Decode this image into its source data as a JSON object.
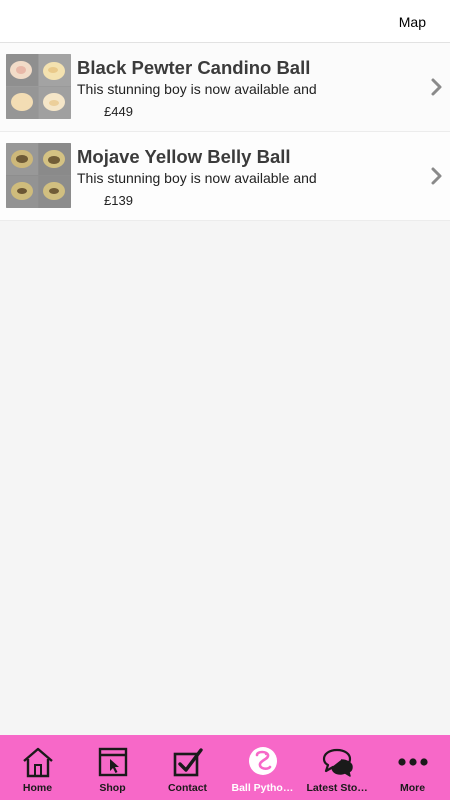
{
  "header": {
    "map_label": "Map"
  },
  "products": [
    {
      "title": "Black Pewter Candino Ball",
      "description": "This stunning boy is now available and",
      "price": "£449"
    },
    {
      "title": "Mojave Yellow Belly Ball",
      "description": "This stunning boy is now available and",
      "price": "£139"
    }
  ],
  "tabbar": {
    "accent_color": "#f768c8",
    "tabs": [
      {
        "label": "Home",
        "icon": "home-icon"
      },
      {
        "label": "Shop",
        "icon": "shop-icon"
      },
      {
        "label": "Contact",
        "icon": "contact-icon"
      },
      {
        "label": "Ball Pythons",
        "icon": "snake-icon",
        "active": true
      },
      {
        "label": "Latest Stoc...",
        "icon": "chat-bubbles-icon"
      },
      {
        "label": "More",
        "icon": "more-icon"
      }
    ]
  }
}
